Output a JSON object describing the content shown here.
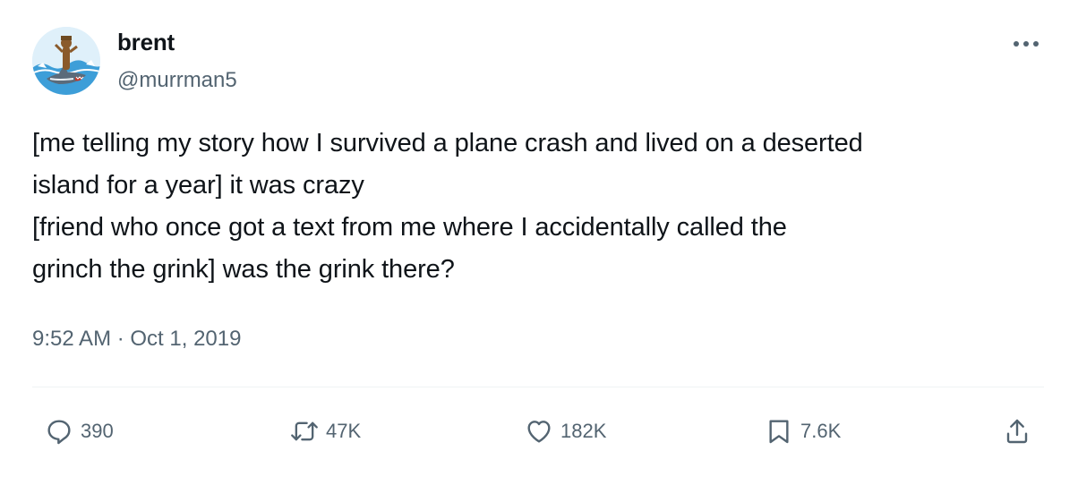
{
  "author": {
    "display_name": "brent",
    "handle": "@murrman5",
    "avatar_icon": "avatar-shark-surfing-icon"
  },
  "menu": {
    "icon": "more-horizontal-icon"
  },
  "tweet": {
    "lines": [
      "[me telling my story how I survived a plane crash and lived on a deserted",
      "island for a year] it was crazy",
      "[friend who once got a text from me where I accidentally called the",
      "grinch the grink] was the grink there?"
    ],
    "timestamp": "9:52 AM · Oct 1, 2019"
  },
  "actions": {
    "reply": {
      "icon": "reply-bubble-icon",
      "count": "390"
    },
    "retweet": {
      "icon": "retweet-icon",
      "count": "47K"
    },
    "like": {
      "icon": "heart-icon",
      "count": "182K"
    },
    "bookmark": {
      "icon": "bookmark-icon",
      "count": "7.6K"
    },
    "share": {
      "icon": "share-icon"
    }
  },
  "colors": {
    "text_primary": "#0f1419",
    "text_secondary": "#536471",
    "divider": "#eff3f4",
    "background": "#ffffff"
  }
}
